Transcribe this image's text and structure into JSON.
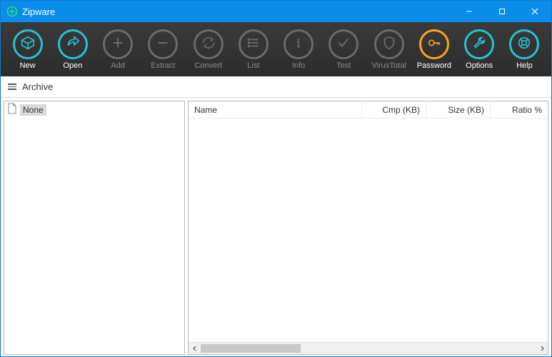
{
  "titlebar": {
    "title": "Zipware"
  },
  "toolbar": {
    "new": "New",
    "open": "Open",
    "add": "Add",
    "extract": "Extract",
    "convert": "Convert",
    "list": "List",
    "info": "Info",
    "test": "Test",
    "virustotal": "VirusTotal",
    "password": "Password",
    "options": "Options",
    "help": "Help"
  },
  "subheader": {
    "label": "Archive"
  },
  "tree": {
    "root": "None"
  },
  "columns": {
    "name": "Name",
    "cmp": "Cmp (KB)",
    "size": "Size (KB)",
    "ratio": "Ratio %"
  }
}
